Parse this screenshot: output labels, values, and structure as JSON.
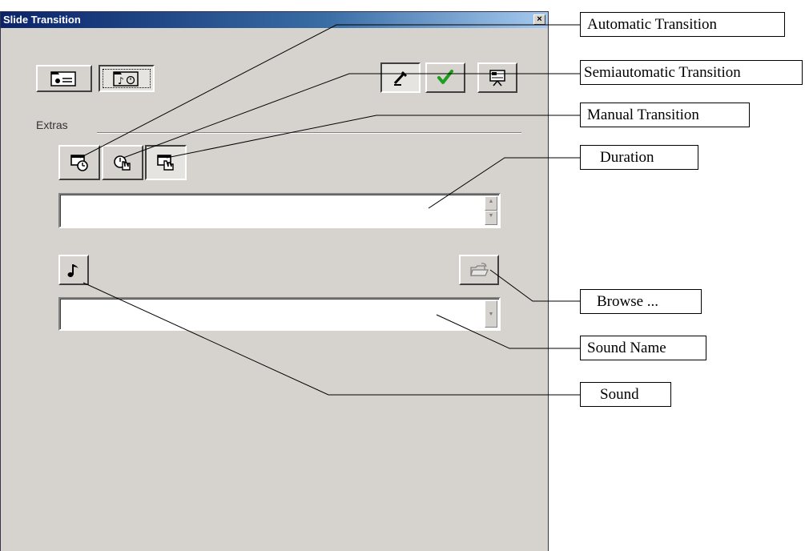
{
  "window": {
    "title": "Slide Transition",
    "close_glyph": "×"
  },
  "extras": {
    "label": "Extras"
  },
  "duration_field": {
    "value": "",
    "spin_up": "▲",
    "spin_down": "▼"
  },
  "sound_name_field": {
    "value": "",
    "dropdown": "▼"
  },
  "top_tabs": [
    {
      "icon": "slide-effects-icon"
    },
    {
      "icon": "slide-timing-icon"
    }
  ],
  "top_actions": [
    {
      "icon": "pencil-icon"
    },
    {
      "icon": "check-icon"
    },
    {
      "icon": "presentation-icon"
    }
  ],
  "transition_buttons": [
    {
      "icon": "automatic-transition-icon"
    },
    {
      "icon": "semiautomatic-transition-icon"
    },
    {
      "icon": "manual-transition-icon"
    }
  ],
  "callouts": {
    "automatic": "Automatic Transition",
    "semiautomatic": "Semiautomatic Transition",
    "manual": "Manual Transition",
    "duration": "Duration",
    "browse": "Browse ...",
    "sound_name": "Sound Name",
    "sound": "Sound"
  },
  "colors": {
    "dialog_bg": "#d6d3ce",
    "titlebar_start": "#0a246a",
    "titlebar_end": "#a6caf0",
    "check_green": "#1e9e1e"
  }
}
